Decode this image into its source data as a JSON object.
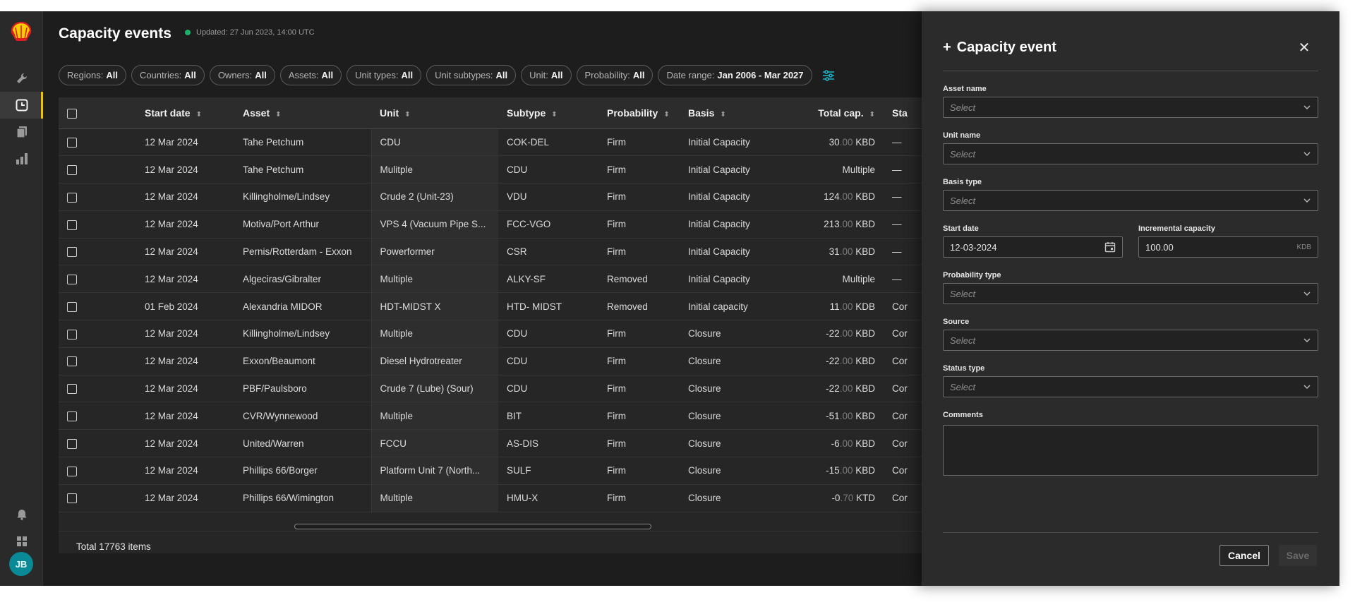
{
  "app": {
    "title": "Capacity events",
    "updated": "Updated: 27 Jun 2023, 14:00 UTC",
    "user_initials": "JB"
  },
  "rail": {
    "items": [
      "wrench-icon",
      "capacity-events-icon",
      "documents-icon",
      "dashboard-icon"
    ],
    "bottom": [
      "bell-icon",
      "apps-grid-icon"
    ]
  },
  "filters": [
    {
      "label": "Regions:",
      "value": "All"
    },
    {
      "label": "Countries:",
      "value": "All"
    },
    {
      "label": "Owners:",
      "value": "All"
    },
    {
      "label": "Assets:",
      "value": "All"
    },
    {
      "label": "Unit types:",
      "value": "All"
    },
    {
      "label": "Unit subtypes:",
      "value": "All"
    },
    {
      "label": "Unit:",
      "value": "All"
    },
    {
      "label": "Probability:",
      "value": "All"
    },
    {
      "label": "Date range:",
      "value": "Jan 2006 - Mar 2027"
    }
  ],
  "table": {
    "columns": [
      "Start date",
      "Asset",
      "Unit",
      "Subtype",
      "Probability",
      "Basis",
      "Total cap.",
      "Sta"
    ],
    "rows": [
      {
        "start": "12 Mar 2024",
        "asset": "Tahe Petchum",
        "unit": "CDU",
        "subtype": "COK-DEL",
        "prob": "Firm",
        "basis": "Initial Capacity",
        "cap_int": "30",
        "cap_dec": ".00",
        "cap_unit": "KBD",
        "status": "—"
      },
      {
        "start": "12 Mar 2024",
        "asset": "Tahe Petchum",
        "unit": "Mulitple",
        "subtype": "CDU",
        "prob": "Firm",
        "basis": "Initial Capacity",
        "cap_int": "Multiple",
        "cap_dec": "",
        "cap_unit": "",
        "status": "—"
      },
      {
        "start": "12 Mar 2024",
        "asset": "Killingholme/Lindsey",
        "unit": "Crude 2 (Unit-23)",
        "subtype": "VDU",
        "prob": "Firm",
        "basis": "Initial Capacity",
        "cap_int": "124",
        "cap_dec": ".00",
        "cap_unit": "KBD",
        "status": "—"
      },
      {
        "start": "12 Mar 2024",
        "asset": "Motiva/Port Arthur",
        "unit": "VPS 4 (Vacuum Pipe S...",
        "subtype": "FCC-VGO",
        "prob": "Firm",
        "basis": "Initial Capacity",
        "cap_int": "213",
        "cap_dec": ".00",
        "cap_unit": "KBD",
        "status": "—"
      },
      {
        "start": "12 Mar 2024",
        "asset": "Pernis/Rotterdam - Exxon",
        "unit": "Powerformer",
        "subtype": "CSR",
        "prob": "Firm",
        "basis": "Initial Capacity",
        "cap_int": "31",
        "cap_dec": ".00",
        "cap_unit": "KBD",
        "status": "—"
      },
      {
        "start": "12 Mar 2024",
        "asset": "Algeciras/Gibralter",
        "unit": "Multiple",
        "subtype": "ALKY-SF",
        "prob": "Removed",
        "basis": "Initial Capacity",
        "cap_int": "Multiple",
        "cap_dec": "",
        "cap_unit": "",
        "status": "—"
      },
      {
        "start": "01 Feb 2024",
        "asset": "Alexandria MIDOR",
        "unit": "HDT-MIDST X",
        "subtype": "HTD- MIDST",
        "prob": "Removed",
        "basis": "Initial capacity",
        "cap_int": "11",
        "cap_dec": ".00",
        "cap_unit": "KDB",
        "status": "Cor"
      },
      {
        "start": "12 Mar 2024",
        "asset": "Killingholme/Lindsey",
        "unit": "Multiple",
        "subtype": "CDU",
        "prob": "Firm",
        "basis": "Closure",
        "cap_int": "-22",
        "cap_dec": ".00",
        "cap_unit": "KBD",
        "status": "Cor"
      },
      {
        "start": "12 Mar 2024",
        "asset": "Exxon/Beaumont",
        "unit": "Diesel Hydrotreater",
        "subtype": "CDU",
        "prob": "Firm",
        "basis": "Closure",
        "cap_int": "-22",
        "cap_dec": ".00",
        "cap_unit": "KBD",
        "status": "Cor"
      },
      {
        "start": "12 Mar 2024",
        "asset": "PBF/Paulsboro",
        "unit": "Crude 7 (Lube) (Sour)",
        "subtype": "CDU",
        "prob": "Firm",
        "basis": "Closure",
        "cap_int": "-22",
        "cap_dec": ".00",
        "cap_unit": "KBD",
        "status": "Cor"
      },
      {
        "start": "12 Mar 2024",
        "asset": "CVR/Wynnewood",
        "unit": "Multiple",
        "subtype": "BIT",
        "prob": "Firm",
        "basis": "Closure",
        "cap_int": "-51",
        "cap_dec": ".00",
        "cap_unit": "KBD",
        "status": "Cor"
      },
      {
        "start": "12 Mar 2024",
        "asset": "United/Warren",
        "unit": "FCCU",
        "subtype": "AS-DIS",
        "prob": "Firm",
        "basis": "Closure",
        "cap_int": "-6",
        "cap_dec": ".00",
        "cap_unit": "KBD",
        "status": "Cor"
      },
      {
        "start": "12 Mar 2024",
        "asset": "Phillips 66/Borger",
        "unit": "Platform Unit 7 (North...",
        "subtype": "SULF",
        "prob": "Firm",
        "basis": "Closure",
        "cap_int": "-15",
        "cap_dec": ".00",
        "cap_unit": "KBD",
        "status": "Cor"
      },
      {
        "start": "12 Mar 2024",
        "asset": "Phillips 66/Wimington",
        "unit": "Multiple",
        "subtype": "HMU-X",
        "prob": "Firm",
        "basis": "Closure",
        "cap_int": "-0",
        "cap_dec": ".70",
        "cap_unit": "KTD",
        "status": "Cor"
      }
    ],
    "total": "Total 17763 items"
  },
  "drawer": {
    "title": "Capacity event",
    "fields": {
      "asset_name": {
        "label": "Asset name",
        "placeholder": "Select"
      },
      "unit_name": {
        "label": "Unit name",
        "placeholder": "Select"
      },
      "basis_type": {
        "label": "Basis type",
        "placeholder": "Select"
      },
      "start_date": {
        "label": "Start date",
        "value": "12-03-2024"
      },
      "incremental_capacity": {
        "label": "Incremental capacity",
        "value": "100.00",
        "unit": "KDB"
      },
      "probability_type": {
        "label": "Probability type",
        "placeholder": "Select"
      },
      "source": {
        "label": "Source",
        "placeholder": "Select"
      },
      "status_type": {
        "label": "Status type",
        "placeholder": "Select"
      },
      "comments": {
        "label": "Comments"
      }
    },
    "cancel_label": "Cancel",
    "save_label": "Save"
  },
  "colors": {
    "accent_active": "#f2c200",
    "filter_icon": "#1bb5c8",
    "status_dot": "#1fae6b",
    "avatar": "#0a8a97"
  }
}
